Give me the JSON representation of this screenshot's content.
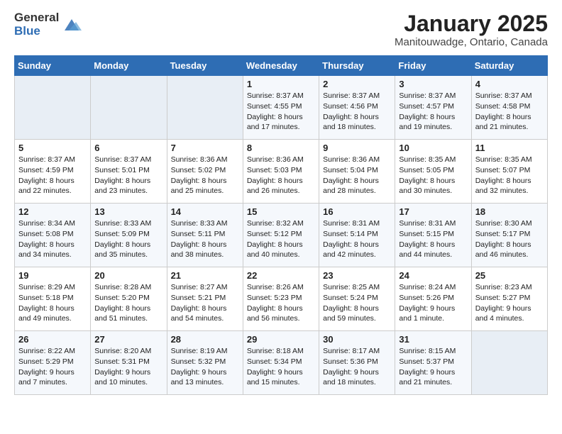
{
  "logo": {
    "general": "General",
    "blue": "Blue"
  },
  "title": "January 2025",
  "location": "Manitouwadge, Ontario, Canada",
  "headers": [
    "Sunday",
    "Monday",
    "Tuesday",
    "Wednesday",
    "Thursday",
    "Friday",
    "Saturday"
  ],
  "weeks": [
    [
      {
        "day": "",
        "sunrise": "",
        "sunset": "",
        "daylight": "",
        "empty": true
      },
      {
        "day": "",
        "sunrise": "",
        "sunset": "",
        "daylight": "",
        "empty": true
      },
      {
        "day": "",
        "sunrise": "",
        "sunset": "",
        "daylight": "",
        "empty": true
      },
      {
        "day": "1",
        "sunrise": "Sunrise: 8:37 AM",
        "sunset": "Sunset: 4:55 PM",
        "daylight": "Daylight: 8 hours and 17 minutes."
      },
      {
        "day": "2",
        "sunrise": "Sunrise: 8:37 AM",
        "sunset": "Sunset: 4:56 PM",
        "daylight": "Daylight: 8 hours and 18 minutes."
      },
      {
        "day": "3",
        "sunrise": "Sunrise: 8:37 AM",
        "sunset": "Sunset: 4:57 PM",
        "daylight": "Daylight: 8 hours and 19 minutes."
      },
      {
        "day": "4",
        "sunrise": "Sunrise: 8:37 AM",
        "sunset": "Sunset: 4:58 PM",
        "daylight": "Daylight: 8 hours and 21 minutes."
      }
    ],
    [
      {
        "day": "5",
        "sunrise": "Sunrise: 8:37 AM",
        "sunset": "Sunset: 4:59 PM",
        "daylight": "Daylight: 8 hours and 22 minutes."
      },
      {
        "day": "6",
        "sunrise": "Sunrise: 8:37 AM",
        "sunset": "Sunset: 5:01 PM",
        "daylight": "Daylight: 8 hours and 23 minutes."
      },
      {
        "day": "7",
        "sunrise": "Sunrise: 8:36 AM",
        "sunset": "Sunset: 5:02 PM",
        "daylight": "Daylight: 8 hours and 25 minutes."
      },
      {
        "day": "8",
        "sunrise": "Sunrise: 8:36 AM",
        "sunset": "Sunset: 5:03 PM",
        "daylight": "Daylight: 8 hours and 26 minutes."
      },
      {
        "day": "9",
        "sunrise": "Sunrise: 8:36 AM",
        "sunset": "Sunset: 5:04 PM",
        "daylight": "Daylight: 8 hours and 28 minutes."
      },
      {
        "day": "10",
        "sunrise": "Sunrise: 8:35 AM",
        "sunset": "Sunset: 5:05 PM",
        "daylight": "Daylight: 8 hours and 30 minutes."
      },
      {
        "day": "11",
        "sunrise": "Sunrise: 8:35 AM",
        "sunset": "Sunset: 5:07 PM",
        "daylight": "Daylight: 8 hours and 32 minutes."
      }
    ],
    [
      {
        "day": "12",
        "sunrise": "Sunrise: 8:34 AM",
        "sunset": "Sunset: 5:08 PM",
        "daylight": "Daylight: 8 hours and 34 minutes."
      },
      {
        "day": "13",
        "sunrise": "Sunrise: 8:33 AM",
        "sunset": "Sunset: 5:09 PM",
        "daylight": "Daylight: 8 hours and 35 minutes."
      },
      {
        "day": "14",
        "sunrise": "Sunrise: 8:33 AM",
        "sunset": "Sunset: 5:11 PM",
        "daylight": "Daylight: 8 hours and 38 minutes."
      },
      {
        "day": "15",
        "sunrise": "Sunrise: 8:32 AM",
        "sunset": "Sunset: 5:12 PM",
        "daylight": "Daylight: 8 hours and 40 minutes."
      },
      {
        "day": "16",
        "sunrise": "Sunrise: 8:31 AM",
        "sunset": "Sunset: 5:14 PM",
        "daylight": "Daylight: 8 hours and 42 minutes."
      },
      {
        "day": "17",
        "sunrise": "Sunrise: 8:31 AM",
        "sunset": "Sunset: 5:15 PM",
        "daylight": "Daylight: 8 hours and 44 minutes."
      },
      {
        "day": "18",
        "sunrise": "Sunrise: 8:30 AM",
        "sunset": "Sunset: 5:17 PM",
        "daylight": "Daylight: 8 hours and 46 minutes."
      }
    ],
    [
      {
        "day": "19",
        "sunrise": "Sunrise: 8:29 AM",
        "sunset": "Sunset: 5:18 PM",
        "daylight": "Daylight: 8 hours and 49 minutes."
      },
      {
        "day": "20",
        "sunrise": "Sunrise: 8:28 AM",
        "sunset": "Sunset: 5:20 PM",
        "daylight": "Daylight: 8 hours and 51 minutes."
      },
      {
        "day": "21",
        "sunrise": "Sunrise: 8:27 AM",
        "sunset": "Sunset: 5:21 PM",
        "daylight": "Daylight: 8 hours and 54 minutes."
      },
      {
        "day": "22",
        "sunrise": "Sunrise: 8:26 AM",
        "sunset": "Sunset: 5:23 PM",
        "daylight": "Daylight: 8 hours and 56 minutes."
      },
      {
        "day": "23",
        "sunrise": "Sunrise: 8:25 AM",
        "sunset": "Sunset: 5:24 PM",
        "daylight": "Daylight: 8 hours and 59 minutes."
      },
      {
        "day": "24",
        "sunrise": "Sunrise: 8:24 AM",
        "sunset": "Sunset: 5:26 PM",
        "daylight": "Daylight: 9 hours and 1 minute."
      },
      {
        "day": "25",
        "sunrise": "Sunrise: 8:23 AM",
        "sunset": "Sunset: 5:27 PM",
        "daylight": "Daylight: 9 hours and 4 minutes."
      }
    ],
    [
      {
        "day": "26",
        "sunrise": "Sunrise: 8:22 AM",
        "sunset": "Sunset: 5:29 PM",
        "daylight": "Daylight: 9 hours and 7 minutes."
      },
      {
        "day": "27",
        "sunrise": "Sunrise: 8:20 AM",
        "sunset": "Sunset: 5:31 PM",
        "daylight": "Daylight: 9 hours and 10 minutes."
      },
      {
        "day": "28",
        "sunrise": "Sunrise: 8:19 AM",
        "sunset": "Sunset: 5:32 PM",
        "daylight": "Daylight: 9 hours and 13 minutes."
      },
      {
        "day": "29",
        "sunrise": "Sunrise: 8:18 AM",
        "sunset": "Sunset: 5:34 PM",
        "daylight": "Daylight: 9 hours and 15 minutes."
      },
      {
        "day": "30",
        "sunrise": "Sunrise: 8:17 AM",
        "sunset": "Sunset: 5:36 PM",
        "daylight": "Daylight: 9 hours and 18 minutes."
      },
      {
        "day": "31",
        "sunrise": "Sunrise: 8:15 AM",
        "sunset": "Sunset: 5:37 PM",
        "daylight": "Daylight: 9 hours and 21 minutes."
      },
      {
        "day": "",
        "sunrise": "",
        "sunset": "",
        "daylight": "",
        "empty": true
      }
    ]
  ]
}
